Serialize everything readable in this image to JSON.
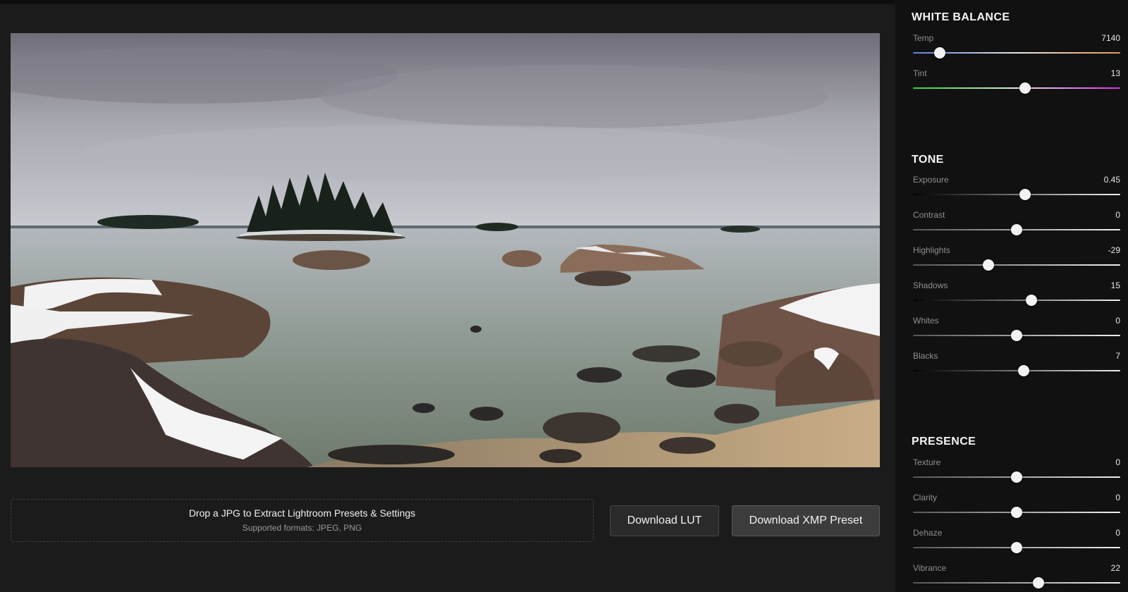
{
  "dropzone": {
    "title": "Drop a JPG to Extract Lightroom Presets & Settings",
    "subtitle": "Supported formats: JPEG, PNG"
  },
  "buttons": {
    "download_lut": "Download LUT",
    "download_xmp": "Download XMP Preset"
  },
  "panel": {
    "white_balance": {
      "title": "WHITE BALANCE",
      "sliders": [
        {
          "label": "Temp",
          "value": "7140",
          "fraction": 0.13
        },
        {
          "label": "Tint",
          "value": "13",
          "fraction": 0.54
        }
      ]
    },
    "tone": {
      "title": "TONE",
      "sliders": [
        {
          "label": "Exposure",
          "value": "0.45",
          "fraction": 0.54
        },
        {
          "label": "Contrast",
          "value": "0",
          "fraction": 0.5
        },
        {
          "label": "Highlights",
          "value": "-29",
          "fraction": 0.365
        },
        {
          "label": "Shadows",
          "value": "15",
          "fraction": 0.57
        },
        {
          "label": "Whites",
          "value": "0",
          "fraction": 0.5
        },
        {
          "label": "Blacks",
          "value": "7",
          "fraction": 0.535
        }
      ]
    },
    "presence": {
      "title": "PRESENCE",
      "sliders": [
        {
          "label": "Texture",
          "value": "0",
          "fraction": 0.5
        },
        {
          "label": "Clarity",
          "value": "0",
          "fraction": 0.5
        },
        {
          "label": "Dehaze",
          "value": "0",
          "fraction": 0.5
        },
        {
          "label": "Vibrance",
          "value": "22",
          "fraction": 0.605
        }
      ]
    }
  },
  "colors": {
    "background": "#1b1b1b",
    "panel": "#111111",
    "temp_track": "linear-gradient(90deg,#5d7fe0,#e6e6e6 50%,#e89a4a)",
    "tint_track": "linear-gradient(90deg,#2ed33a,#e6e6e6 50%,#d52fe0)",
    "tone_track": "linear-gradient(90deg,#000000,#f0f0f0)",
    "neutral_track": "linear-gradient(90deg,#555555,#f0f0f0)"
  },
  "photo": {
    "subject": "coastal landscape with snowy boulders, islands and overcast sky"
  }
}
